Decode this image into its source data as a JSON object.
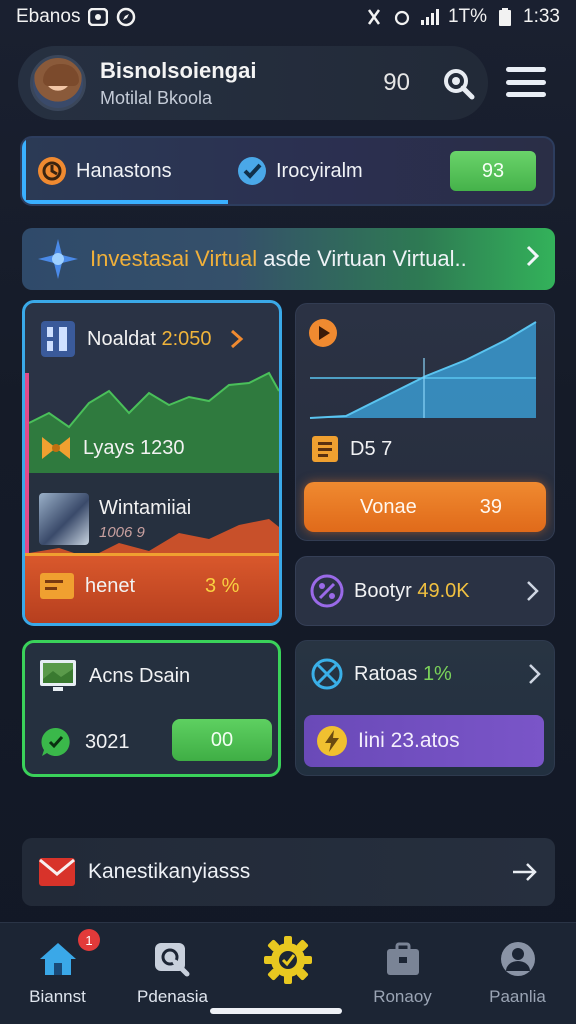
{
  "status_bar": {
    "left_text": "Ebanos",
    "right_battery": "1T%",
    "time": "1:33"
  },
  "header": {
    "user_name": "Bisnolsoiengai",
    "user_sub": "Motilal Bkoola",
    "count": "90"
  },
  "tabs": [
    {
      "label": "Hanastons",
      "icon": "clock-icon"
    },
    {
      "label": "Irocyiralm",
      "icon": "check-shield-icon"
    }
  ],
  "tab_badge": "93",
  "banner": {
    "highlight": "Investasai Virtual",
    "rest": "asde Virtuan Virtual..",
    "icon": "star-compass-icon"
  },
  "card_left": {
    "title_prefix": "Noaldat",
    "title_value": "2:050",
    "stat_label": "Lyays 1230",
    "media_title": "Wintamiiai",
    "media_sub": "1006 9",
    "bottom_label": "henet",
    "bottom_value": "3 %"
  },
  "card_right_top": {
    "label": "D5 7",
    "button_label": "Vonae",
    "button_value": "39"
  },
  "card_right_mid": {
    "label": "Bootyr",
    "value": "49.0K"
  },
  "card_green": {
    "title": "Acns Dsain",
    "value": "3021",
    "button": "00"
  },
  "card_right_bot": {
    "label": "Ratoas",
    "value": "1%",
    "button_label": "Iini 23.atos"
  },
  "message": {
    "text": "Kanestikanyiasss"
  },
  "nav": [
    {
      "label": "Biannst",
      "icon": "home-icon",
      "badge": "1"
    },
    {
      "label": "Pdenasia",
      "icon": "search-icon"
    },
    {
      "label": "",
      "icon": "gear-icon"
    },
    {
      "label": "Ronaoy",
      "icon": "briefcase-icon"
    },
    {
      "label": "Paanlia",
      "icon": "user-icon"
    }
  ],
  "colors": {
    "accent_blue": "#3ab0ff",
    "accent_green": "#3ad25a",
    "accent_orange": "#f08a30",
    "accent_purple": "#7a55c8"
  }
}
